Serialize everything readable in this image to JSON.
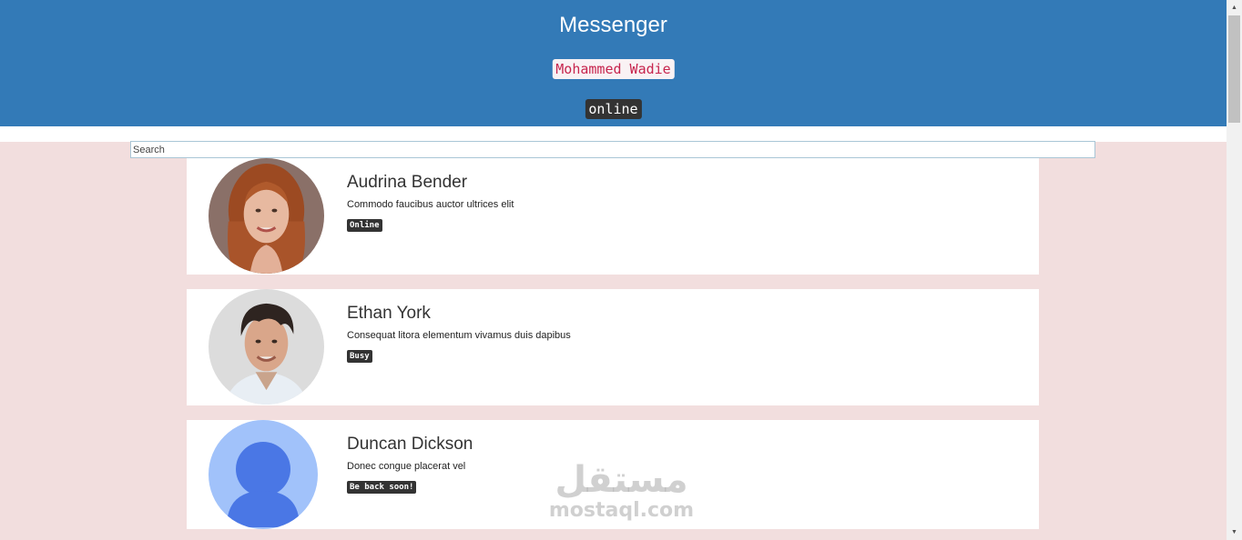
{
  "header": {
    "title": "Messenger",
    "user_name": "Mohammed Wadie",
    "user_status": "online",
    "background": "#337ab7"
  },
  "search": {
    "placeholder": "Search",
    "value": ""
  },
  "contacts": [
    {
      "name": "Audrina Bender",
      "message": "Commodo faucibus auctor ultrices elit",
      "status": "Online",
      "avatar_icon": "woman-photo-avatar"
    },
    {
      "name": "Ethan York",
      "message": "Consequat litora elementum vivamus duis dapibus",
      "status": "Busy",
      "avatar_icon": "man-photo-avatar"
    },
    {
      "name": "Duncan Dickson",
      "message": "Donec congue placerat vel",
      "status": "Be back soon!",
      "avatar_icon": "default-user-avatar"
    }
  ],
  "watermark": {
    "arabic": "مستقل",
    "latin": "mostaql.com"
  },
  "colors": {
    "page_background": "#f2dede",
    "badge": "#333333",
    "name_highlight": "#c7254e"
  }
}
